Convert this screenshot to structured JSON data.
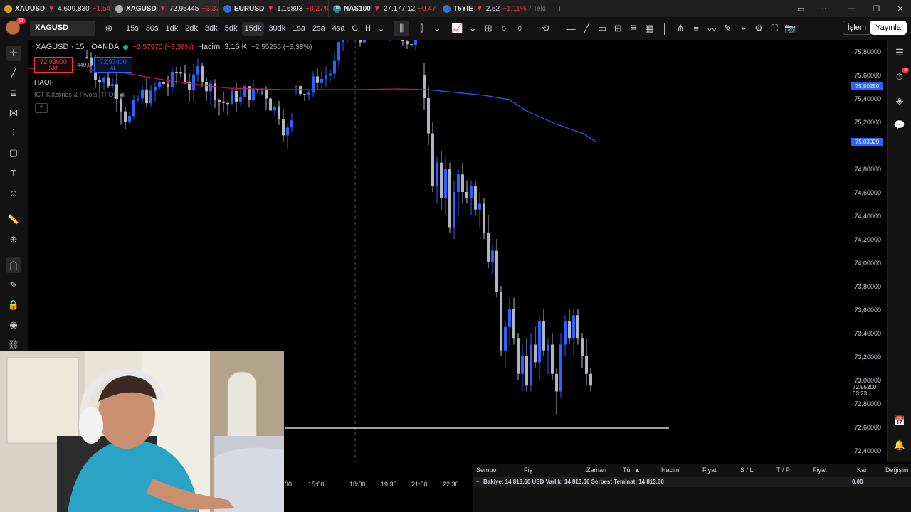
{
  "tabs": [
    {
      "symbol": "XAUUSD",
      "price": "4.609,830",
      "change": "−1,54",
      "arrow": "▼",
      "icon_color": "#d4a017"
    },
    {
      "symbol": "XAGUSD",
      "price": "72,95445",
      "change": "−3,37%",
      "arrow": "▼",
      "icon_color": "#b0b0b0"
    },
    {
      "symbol": "EURUSD",
      "price": "1,16893",
      "change": "−0,27%",
      "arrow": "▼",
      "icon_color": "#3b6bd6"
    },
    {
      "symbol": "NAS100",
      "price": "27.177,12",
      "change": "−0,47",
      "arrow": "▼",
      "icon_color": "#2a8d8d",
      "icon_text": "100"
    },
    {
      "symbol": "T5YIE",
      "price": "2,62",
      "change": "−1,11%",
      "arrow": "▼",
      "icon_color": "#3b6bd6",
      "suffix": "/ Teki"
    }
  ],
  "toolbar": {
    "notifications": "11",
    "symbol": "XAGUSD",
    "intervals": [
      "15s",
      "30s",
      "1dk",
      "2dk",
      "3dk",
      "5dk",
      "15dk",
      "30dk",
      "1sa",
      "2sa",
      "4sa",
      "G",
      "H"
    ],
    "active_interval": "15dk",
    "counter_a": "5",
    "counter_b": "0",
    "trade_label": "İşlem",
    "publish_label": "Yayınla"
  },
  "legend": {
    "title": "XAGUSD · 15 · OANDA",
    "change": "−2,57970 (−3,38%)",
    "volume_label": "Hacim",
    "volume_value": "3,16 K",
    "volume_change": "−2,55255 (−3,38%)"
  },
  "order": {
    "sell_price": "72,93000",
    "sell_label": "SAT",
    "spread": "440,0",
    "buy_price": "72,97400",
    "buy_label": "AL"
  },
  "indicators": {
    "haof": "HAOF",
    "ict": "ICT Killzones & Pivots [TFO]"
  },
  "price_axis": {
    "ticks": [
      "75,80000",
      "75,60000",
      "75,40000",
      "75,20000",
      "74,80000",
      "74,60000",
      "74,40000",
      "74,20000",
      "74,00000",
      "73,80000",
      "73,60000",
      "73,40000",
      "73,20000",
      "73,00000",
      "72,80000",
      "72,60000",
      "72,40000"
    ],
    "tag_blue_1": "75,50250",
    "tag_blue_2": "75,03029",
    "current_price": "72,95200",
    "countdown": "03:23"
  },
  "time_axis": [
    "30",
    "15:00",
    "18:00",
    "19:30",
    "21:00",
    "22:30"
  ],
  "trade_panel": {
    "headers": [
      "Sembol",
      "Fiş",
      "Zaman",
      "Tür ▲",
      "Hacim",
      "Fiyat",
      "S / L",
      "T / P",
      "Fiyat",
      "Kar",
      "Değişim"
    ],
    "balance_text": "Bakiye: 14 813.60 USD  Varlık: 14 813.60  Serbest Teminat: 14 813.60",
    "profit": "0.00"
  },
  "colors": {
    "up": "#2962ff",
    "down": "#b2b5be",
    "ma_red": "#c2185b",
    "ma_blue": "#2962ff",
    "accent_red": "#f23645"
  },
  "chart_data": {
    "type": "candlestick",
    "timeframe": "15",
    "ylim": [
      72.4,
      75.8
    ],
    "visible_lows": [
      72.68,
      72.9,
      72.95
    ]
  }
}
